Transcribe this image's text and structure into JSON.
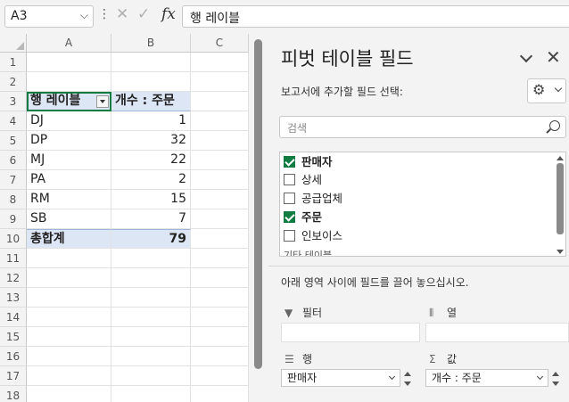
{
  "formula_bar": {
    "name_box": "A3",
    "formula": "행 레이블"
  },
  "columns": [
    "A",
    "B",
    "C"
  ],
  "rows": [
    "1",
    "2",
    "3",
    "4",
    "5",
    "6",
    "7",
    "8",
    "9",
    "10",
    "11",
    "12",
    "13",
    "14",
    "15",
    "16",
    "17",
    "18"
  ],
  "pivot": {
    "header_label": "행 레이블",
    "header_value": "개수 : 주문",
    "items": [
      {
        "label": "DJ",
        "value": "1"
      },
      {
        "label": "DP",
        "value": "32"
      },
      {
        "label": "MJ",
        "value": "22"
      },
      {
        "label": "PA",
        "value": "2"
      },
      {
        "label": "RM",
        "value": "15"
      },
      {
        "label": "SB",
        "value": "7"
      }
    ],
    "total_label": "총합계",
    "total_value": "79"
  },
  "pane": {
    "title": "피벗 테이블 필드",
    "subtitle": "보고서에 추가할 필드 선택:",
    "search_placeholder": "검색",
    "fields": [
      {
        "label": "판매자",
        "checked": true
      },
      {
        "label": "상세",
        "checked": false
      },
      {
        "label": "공급업체",
        "checked": false
      },
      {
        "label": "주문",
        "checked": true
      },
      {
        "label": "인보이스",
        "checked": false
      },
      {
        "label": "기타 테이블...",
        "checked": false
      }
    ],
    "instruction": "아래 영역 사이에 필드를 끌어 놓으십시오.",
    "areas": {
      "filters": "필터",
      "columns": "열",
      "rows": "행",
      "values": "값",
      "rows_item": "판매자",
      "values_item": "개수 : 주문"
    }
  }
}
